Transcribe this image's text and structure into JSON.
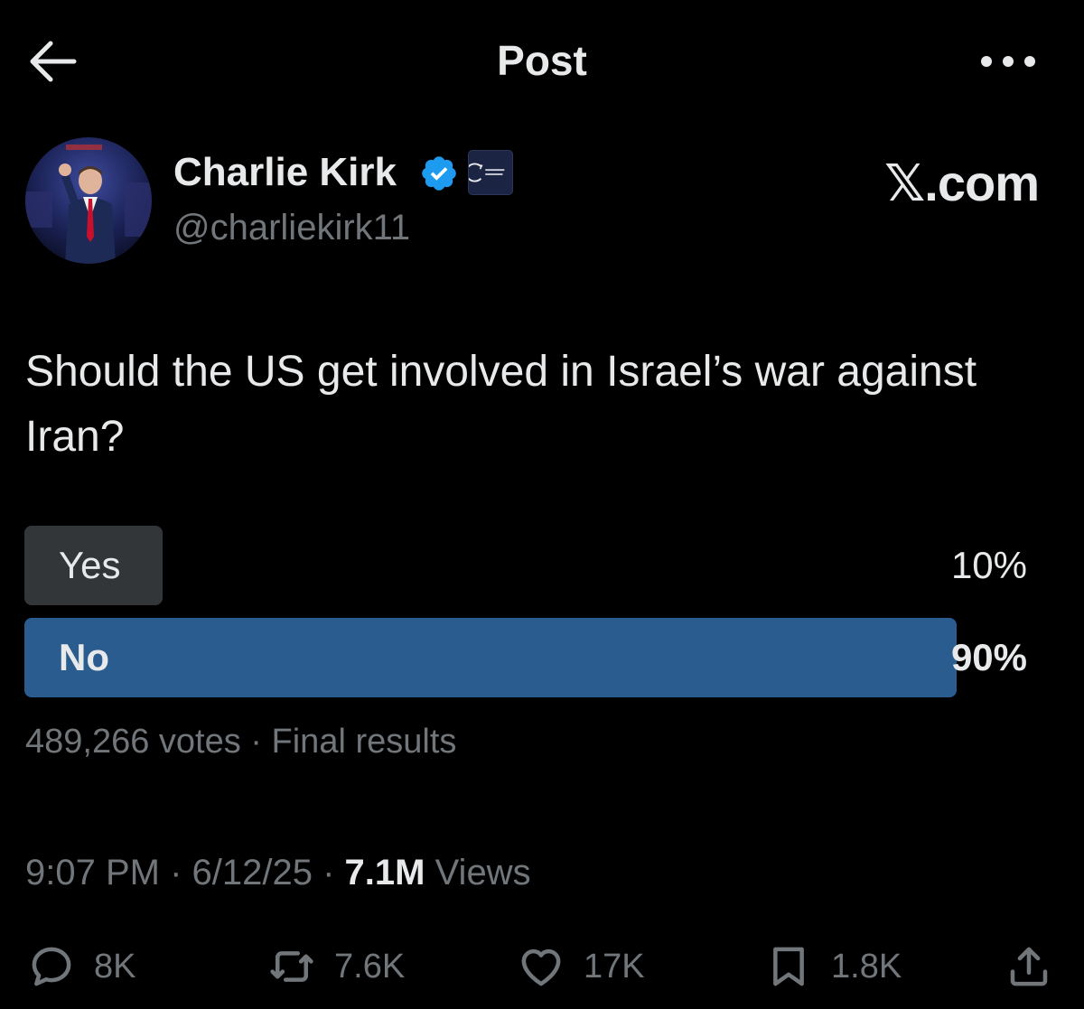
{
  "header": {
    "title": "Post",
    "back_icon": "arrow-left-icon",
    "more_icon": "more-horizontal-icon"
  },
  "author": {
    "name": "Charlie Kirk",
    "handle": "@charliekirk11",
    "verified": true,
    "verified_color": "#1d9bf0"
  },
  "watermark": "𝕏.com",
  "post": {
    "text": "Should the US get involved in Israel’s war against Iran?"
  },
  "poll": {
    "options": [
      {
        "label": "Yes",
        "percent_label": "10%",
        "percent": 10,
        "leading": false
      },
      {
        "label": "No",
        "percent_label": "90%",
        "percent": 90,
        "leading": true
      }
    ],
    "votes": "489,266 votes",
    "status": "Final results",
    "leading_color": "#2a5c8f",
    "other_color": "#333639"
  },
  "meta": {
    "time": "9:07 PM",
    "date": "6/12/25",
    "views_count": "7.1M",
    "views_label": "Views"
  },
  "actions": {
    "replies": "8K",
    "reposts": "7.6K",
    "likes": "17K",
    "bookmarks": "1.8K"
  },
  "colors": {
    "background": "#000000",
    "primary_text": "#e7e9ea",
    "secondary_text": "#71767b"
  }
}
